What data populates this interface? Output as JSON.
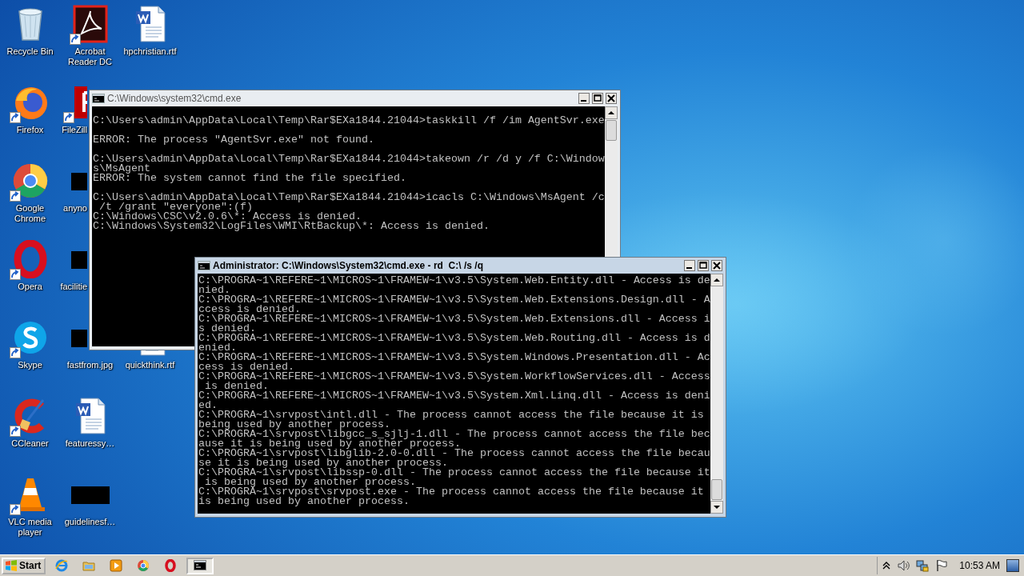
{
  "desktop": {
    "icon_columns": [
      [
        {
          "label": "Recycle Bin",
          "shortcut": false
        },
        {
          "label": "Firefox",
          "shortcut": true
        },
        {
          "label": "Google Chrome",
          "shortcut": true
        },
        {
          "label": "Opera",
          "shortcut": true
        },
        {
          "label": "Skype",
          "shortcut": true
        },
        {
          "label": "CCleaner",
          "shortcut": true
        },
        {
          "label": "VLC media player",
          "shortcut": true
        }
      ],
      [
        {
          "label": "Acrobat Reader DC",
          "shortcut": true
        },
        {
          "label": "FileZill",
          "shortcut": true
        },
        {
          "label": "anyno",
          "shortcut": false
        },
        {
          "label": "facilitie",
          "shortcut": false
        },
        {
          "label": "fastfrom.jpg",
          "shortcut": false
        },
        {
          "label": "featuressy…",
          "shortcut": false
        },
        {
          "label": "guidelinesf…",
          "shortcut": false
        }
      ],
      [
        {
          "label": "hpchristian.rtf",
          "shortcut": false
        },
        {
          "label": "quickthink.rtf",
          "shortcut": false
        }
      ]
    ]
  },
  "windows": [
    {
      "title": "C:\\Windows\\system32\\cmd.exe",
      "active": false,
      "console": {
        "blocks": [
          [
            "C:\\Users\\admin\\AppData\\Local\\Temp\\Rar$EXa1844.21044>taskkill /f /im AgentSvr.exe"
          ],
          [
            "ERROR: The process \"AgentSvr.exe\" not found."
          ],
          [
            "C:\\Users\\admin\\AppData\\Local\\Temp\\Rar$EXa1844.21044>takeown /r /d y /f C:\\Window",
            "s\\MsAgent",
            "ERROR: The system cannot find the file specified."
          ],
          [
            "C:\\Users\\admin\\AppData\\Local\\Temp\\Rar$EXa1844.21044>icacls C:\\Windows\\MsAgent /c",
            " /t /grant \"everyone\":(f)",
            "C:\\Windows\\CSC\\v2.0.6\\*: Access is denied.",
            "C:\\Windows\\System32\\LogFiles\\WMI\\RtBackup\\*: Access is denied."
          ]
        ]
      }
    },
    {
      "title": "Administrator: C:\\Windows\\System32\\cmd.exe - rd  C:\\ /s /q",
      "active": true,
      "console": {
        "blocks": [
          [
            "C:\\PROGRA~1\\REFERE~1\\MICROS~1\\FRAMEW~1\\v3.5\\System.Web.Entity.dll - Access is de",
            "nied.",
            "C:\\PROGRA~1\\REFERE~1\\MICROS~1\\FRAMEW~1\\v3.5\\System.Web.Extensions.Design.dll - A",
            "ccess is denied.",
            "C:\\PROGRA~1\\REFERE~1\\MICROS~1\\FRAMEW~1\\v3.5\\System.Web.Extensions.dll - Access i",
            "s denied.",
            "C:\\PROGRA~1\\REFERE~1\\MICROS~1\\FRAMEW~1\\v3.5\\System.Web.Routing.dll - Access is d",
            "enied.",
            "C:\\PROGRA~1\\REFERE~1\\MICROS~1\\FRAMEW~1\\v3.5\\System.Windows.Presentation.dll - Ac",
            "cess is denied.",
            "C:\\PROGRA~1\\REFERE~1\\MICROS~1\\FRAMEW~1\\v3.5\\System.WorkflowServices.dll - Access",
            " is denied.",
            "C:\\PROGRA~1\\REFERE~1\\MICROS~1\\FRAMEW~1\\v3.5\\System.Xml.Linq.dll - Access is deni",
            "ed.",
            "C:\\PROGRA~1\\srvpost\\intl.dll - The process cannot access the file because it is",
            "being used by another process.",
            "C:\\PROGRA~1\\srvpost\\libgcc_s_sjlj-1.dll - The process cannot access the file bec",
            "ause it is being used by another process.",
            "C:\\PROGRA~1\\srvpost\\libglib-2.0-0.dll - The process cannot access the file becau",
            "se it is being used by another process.",
            "C:\\PROGRA~1\\srvpost\\libssp-0.dll - The process cannot access the file because it",
            " is being used by another process.",
            "C:\\PROGRA~1\\srvpost\\srvpost.exe - The process cannot access the file because it",
            "is being used by another process."
          ]
        ]
      }
    }
  ],
  "taskbar": {
    "start_label": "Start",
    "apps": [
      {
        "selected": false
      },
      {
        "selected": false
      },
      {
        "selected": false
      },
      {
        "selected": false
      },
      {
        "selected": false
      },
      {
        "selected": true
      }
    ],
    "clock": "10:53 AM"
  }
}
